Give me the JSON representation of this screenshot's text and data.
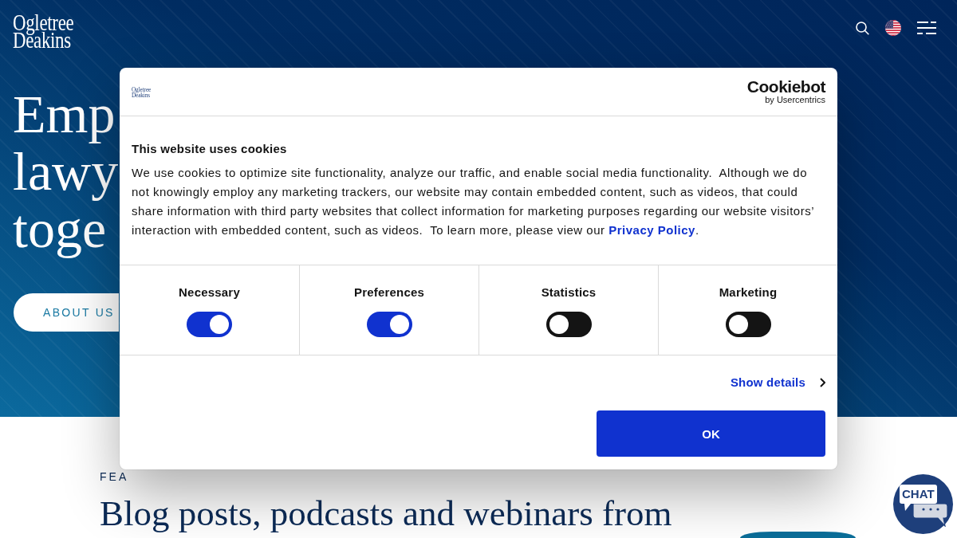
{
  "header": {
    "logo": "Ogletree Deakins"
  },
  "hero": {
    "heading": "Emp lawy toge",
    "button": "ABOUT US"
  },
  "cookie_dialog": {
    "logo": "Ogletree Deakins",
    "brand": "Cookiebot",
    "brand_byline": "by Usercentrics",
    "title": "This website uses cookies",
    "text": "We use cookies to optimize site functionality, analyze our traffic, and enable social media functionality.  Although we do not knowingly employ any marketing trackers, our website may contain embedded content, such as videos, that could share information with third party websites that collect information for marketing purposes regarding our website visitors’ interaction with embedded content, such as videos.  To learn more, please view our ",
    "link": "Privacy Policy",
    "text_end": ".",
    "categories": [
      {
        "label": "Necessary",
        "on": true
      },
      {
        "label": "Preferences",
        "on": true
      },
      {
        "label": "Statistics",
        "on": false
      },
      {
        "label": "Marketing",
        "on": false
      }
    ],
    "details_link": "Show details",
    "ok_button": "OK"
  },
  "featured": {
    "eyebrow": "FEA",
    "heading": "Blog posts, podcasts and webinars from"
  },
  "chat": {
    "label": "CHAT"
  }
}
